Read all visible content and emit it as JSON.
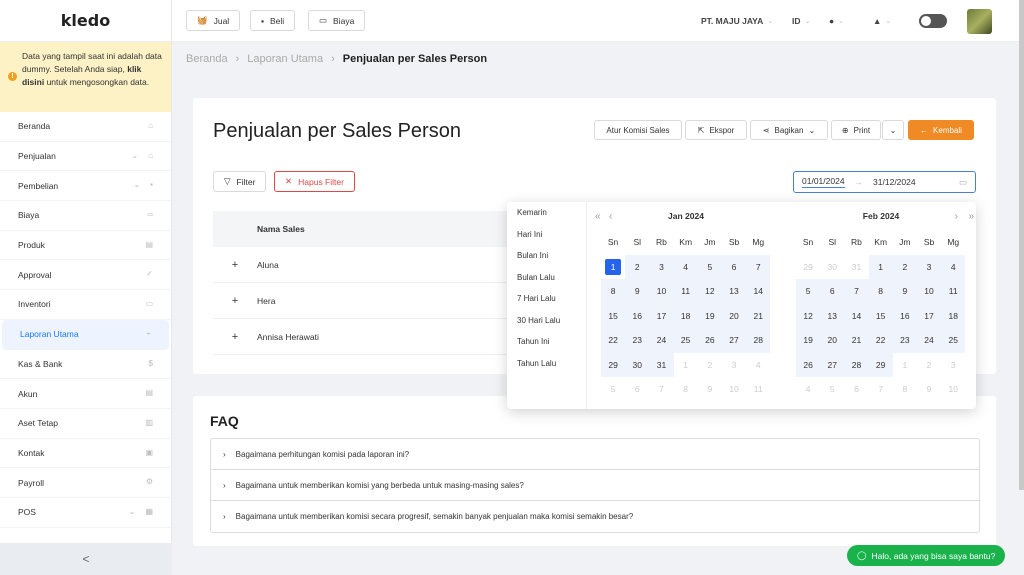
{
  "sidebar": {
    "logo": "kledo",
    "notice": {
      "pre": "Data yang tampil saat ini adalah data dummy. Setelah Anda siap, ",
      "link": "klik disini",
      "post": " untuk mengosongkan data."
    },
    "items": [
      {
        "label": "Beranda",
        "icon": "home-icon"
      },
      {
        "label": "Penjualan",
        "icon": "basket-icon",
        "chev": true
      },
      {
        "label": "Pembelian",
        "icon": "bag-icon",
        "chev": true
      },
      {
        "label": "Biaya",
        "icon": "money-icon"
      },
      {
        "label": "Produk",
        "icon": "boxes-icon"
      },
      {
        "label": "Approval",
        "icon": "check-icon"
      },
      {
        "label": "Inventori",
        "icon": "briefcase-icon"
      },
      {
        "label": "Laporan Utama",
        "icon": "chart-icon",
        "active": true
      },
      {
        "label": "Kas & Bank",
        "icon": "dollar-icon"
      },
      {
        "label": "Akun",
        "icon": "ledger-icon"
      },
      {
        "label": "Aset Tetap",
        "icon": "building-icon"
      },
      {
        "label": "Kontak",
        "icon": "contact-icon"
      },
      {
        "label": "Payroll",
        "icon": "gear-icon"
      },
      {
        "label": "POS",
        "icon": "pos-icon",
        "chev": true
      }
    ],
    "collapse": "<"
  },
  "topbar": {
    "jual": "Jual",
    "beli": "Beli",
    "biaya": "Biaya",
    "company": "PT. MAJU JAYA",
    "lang": "ID"
  },
  "breadcrumb": {
    "home": "Beranda",
    "section": "Laporan Utama",
    "current": "Penjualan per Sales Person"
  },
  "page": {
    "title": "Penjualan per Sales Person",
    "atur": "Atur Komisi Sales",
    "ekspor": "Ekspor",
    "bagikan": "Bagikan",
    "print": "Print",
    "kembali": "Kembali",
    "filter": "Filter",
    "hapus": "Hapus Filter",
    "date_start": "01/01/2024",
    "date_end": "31/12/2024",
    "table": {
      "header": "Nama Sales",
      "rows": [
        "Aluna",
        "Hera",
        "Annisa Herawati"
      ]
    }
  },
  "datepicker": {
    "presets": [
      "Kemarin",
      "Hari Ini",
      "Bulan Ini",
      "Bulan Lalu",
      "7 Hari Lalu",
      "30 Hari Lalu",
      "Tahun Ini",
      "Tahun Lalu"
    ],
    "weekdays": [
      "Sn",
      "Sl",
      "Rb",
      "Km",
      "Jm",
      "Sb",
      "Mg"
    ],
    "months": [
      {
        "title": "Jan  2024",
        "days": [
          {
            "d": "1",
            "t": "sel"
          },
          {
            "d": "2",
            "t": "in"
          },
          {
            "d": "3",
            "t": "in"
          },
          {
            "d": "4",
            "t": "in"
          },
          {
            "d": "5",
            "t": "in"
          },
          {
            "d": "6",
            "t": "in"
          },
          {
            "d": "7",
            "t": "in"
          },
          {
            "d": "8",
            "t": "in"
          },
          {
            "d": "9",
            "t": "in"
          },
          {
            "d": "10",
            "t": "in"
          },
          {
            "d": "11",
            "t": "in"
          },
          {
            "d": "12",
            "t": "in"
          },
          {
            "d": "13",
            "t": "in"
          },
          {
            "d": "14",
            "t": "in"
          },
          {
            "d": "15",
            "t": "in"
          },
          {
            "d": "16",
            "t": "in"
          },
          {
            "d": "17",
            "t": "in"
          },
          {
            "d": "18",
            "t": "in"
          },
          {
            "d": "19",
            "t": "in"
          },
          {
            "d": "20",
            "t": "in"
          },
          {
            "d": "21",
            "t": "in"
          },
          {
            "d": "22",
            "t": "in"
          },
          {
            "d": "23",
            "t": "in"
          },
          {
            "d": "24",
            "t": "in"
          },
          {
            "d": "25",
            "t": "in"
          },
          {
            "d": "26",
            "t": "in"
          },
          {
            "d": "27",
            "t": "in"
          },
          {
            "d": "28",
            "t": "in"
          },
          {
            "d": "29",
            "t": "in"
          },
          {
            "d": "30",
            "t": "in"
          },
          {
            "d": "31",
            "t": "in"
          },
          {
            "d": "1",
            "t": "out"
          },
          {
            "d": "2",
            "t": "out"
          },
          {
            "d": "3",
            "t": "out"
          },
          {
            "d": "4",
            "t": "out"
          },
          {
            "d": "5",
            "t": "out"
          },
          {
            "d": "6",
            "t": "out"
          },
          {
            "d": "7",
            "t": "out"
          },
          {
            "d": "8",
            "t": "out"
          },
          {
            "d": "9",
            "t": "out"
          },
          {
            "d": "10",
            "t": "out"
          },
          {
            "d": "11",
            "t": "out"
          }
        ]
      },
      {
        "title": "Feb  2024",
        "days": [
          {
            "d": "29",
            "t": "out"
          },
          {
            "d": "30",
            "t": "out"
          },
          {
            "d": "31",
            "t": "out"
          },
          {
            "d": "1",
            "t": "in"
          },
          {
            "d": "2",
            "t": "in"
          },
          {
            "d": "3",
            "t": "in"
          },
          {
            "d": "4",
            "t": "in"
          },
          {
            "d": "5",
            "t": "in"
          },
          {
            "d": "6",
            "t": "in"
          },
          {
            "d": "7",
            "t": "in"
          },
          {
            "d": "8",
            "t": "in"
          },
          {
            "d": "9",
            "t": "in"
          },
          {
            "d": "10",
            "t": "in"
          },
          {
            "d": "11",
            "t": "in"
          },
          {
            "d": "12",
            "t": "in"
          },
          {
            "d": "13",
            "t": "in"
          },
          {
            "d": "14",
            "t": "in"
          },
          {
            "d": "15",
            "t": "in"
          },
          {
            "d": "16",
            "t": "in"
          },
          {
            "d": "17",
            "t": "in"
          },
          {
            "d": "18",
            "t": "in"
          },
          {
            "d": "19",
            "t": "in"
          },
          {
            "d": "20",
            "t": "in"
          },
          {
            "d": "21",
            "t": "in"
          },
          {
            "d": "22",
            "t": "in"
          },
          {
            "d": "23",
            "t": "in"
          },
          {
            "d": "24",
            "t": "in"
          },
          {
            "d": "25",
            "t": "in"
          },
          {
            "d": "26",
            "t": "in"
          },
          {
            "d": "27",
            "t": "in"
          },
          {
            "d": "28",
            "t": "in"
          },
          {
            "d": "29",
            "t": "in"
          },
          {
            "d": "1",
            "t": "out"
          },
          {
            "d": "2",
            "t": "out"
          },
          {
            "d": "3",
            "t": "out"
          },
          {
            "d": "4",
            "t": "out"
          },
          {
            "d": "5",
            "t": "out"
          },
          {
            "d": "6",
            "t": "out"
          },
          {
            "d": "7",
            "t": "out"
          },
          {
            "d": "8",
            "t": "out"
          },
          {
            "d": "9",
            "t": "out"
          },
          {
            "d": "10",
            "t": "out"
          }
        ]
      }
    ]
  },
  "faq": {
    "title": "FAQ",
    "items": [
      "Bagaimana perhitungan komisi pada laporan ini?",
      "Bagaimana untuk memberikan komisi yang berbeda untuk masing-masing sales?",
      "Bagaimana untuk memberikan komisi secara progresif, semakin banyak penjualan maka komisi semakin besar?"
    ]
  },
  "help": "Halo, ada yang bisa saya bantu?",
  "colors": {
    "accent": "#1677ff",
    "orange": "#f08a24",
    "danger": "#e04848",
    "whatsapp": "#19b24b"
  }
}
